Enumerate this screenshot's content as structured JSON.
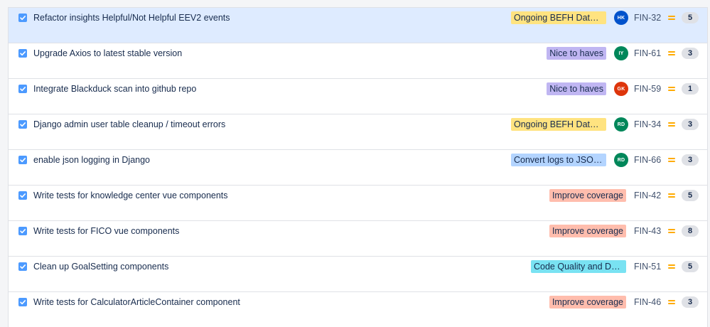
{
  "colors": {
    "selected_row": "#deebff",
    "checkbox": "#4c9aff",
    "priority_medium": "#ffab00",
    "epic_yellow": "#ffe380",
    "epic_purple": "#c0b6f2",
    "epic_blue": "#b3d4ff",
    "epic_red": "#ffbdad",
    "epic_teal": "#79e2f2"
  },
  "issues": [
    {
      "summary": "Refactor insights Helpful/Not Helpful EEV2 events",
      "epic": "Ongoing BEFH Data M...",
      "epic_color": "#ffe380",
      "assignee_initials": "HK",
      "assignee_color": "#0052cc",
      "key": "FIN-32",
      "priority_icon": "priority-medium-icon",
      "points": "5",
      "selected": true
    },
    {
      "summary": "Upgrade Axios to latest stable version",
      "epic": "Nice to haves",
      "epic_color": "#c0b6f2",
      "assignee_initials": "IY",
      "assignee_color": "#00875a",
      "key": "FIN-61",
      "priority_icon": "priority-medium-icon",
      "points": "3"
    },
    {
      "summary": "Integrate Blackduck scan into github repo",
      "epic": "Nice to haves",
      "epic_color": "#c0b6f2",
      "assignee_initials": "GK",
      "assignee_color": "#de350b",
      "key": "FIN-59",
      "priority_icon": "priority-medium-icon",
      "points": "1"
    },
    {
      "summary": "Django admin user table cleanup / timeout errors",
      "epic": "Ongoing BEFH Data M...",
      "epic_color": "#ffe380",
      "assignee_initials": "RD",
      "assignee_color": "#00875a",
      "key": "FIN-34",
      "priority_icon": "priority-medium-icon",
      "points": "3"
    },
    {
      "summary": "enable json logging in Django",
      "epic": "Convert logs to JSON ...",
      "epic_color": "#b3d4ff",
      "assignee_initials": "RD",
      "assignee_color": "#00875a",
      "key": "FIN-66",
      "priority_icon": "priority-medium-icon",
      "points": "3"
    },
    {
      "summary": "Write tests for knowledge center vue components",
      "epic": "Improve coverage",
      "epic_color": "#ffbdad",
      "assignee_initials": "",
      "key": "FIN-42",
      "priority_icon": "priority-medium-icon",
      "points": "5"
    },
    {
      "summary": "Write tests for FICO vue components",
      "epic": "Improve coverage",
      "epic_color": "#ffbdad",
      "assignee_initials": "",
      "key": "FIN-43",
      "priority_icon": "priority-medium-icon",
      "points": "8"
    },
    {
      "summary": "Clean up GoalSetting components",
      "epic": "Code Quality and Doc...",
      "epic_color": "#79e2f2",
      "assignee_initials": "",
      "key": "FIN-51",
      "priority_icon": "priority-medium-icon",
      "points": "5"
    },
    {
      "summary": "Write tests for CalculatorArticleContainer component",
      "epic": "Improve coverage",
      "epic_color": "#ffbdad",
      "assignee_initials": "",
      "key": "FIN-46",
      "priority_icon": "priority-medium-icon",
      "points": "3"
    }
  ]
}
